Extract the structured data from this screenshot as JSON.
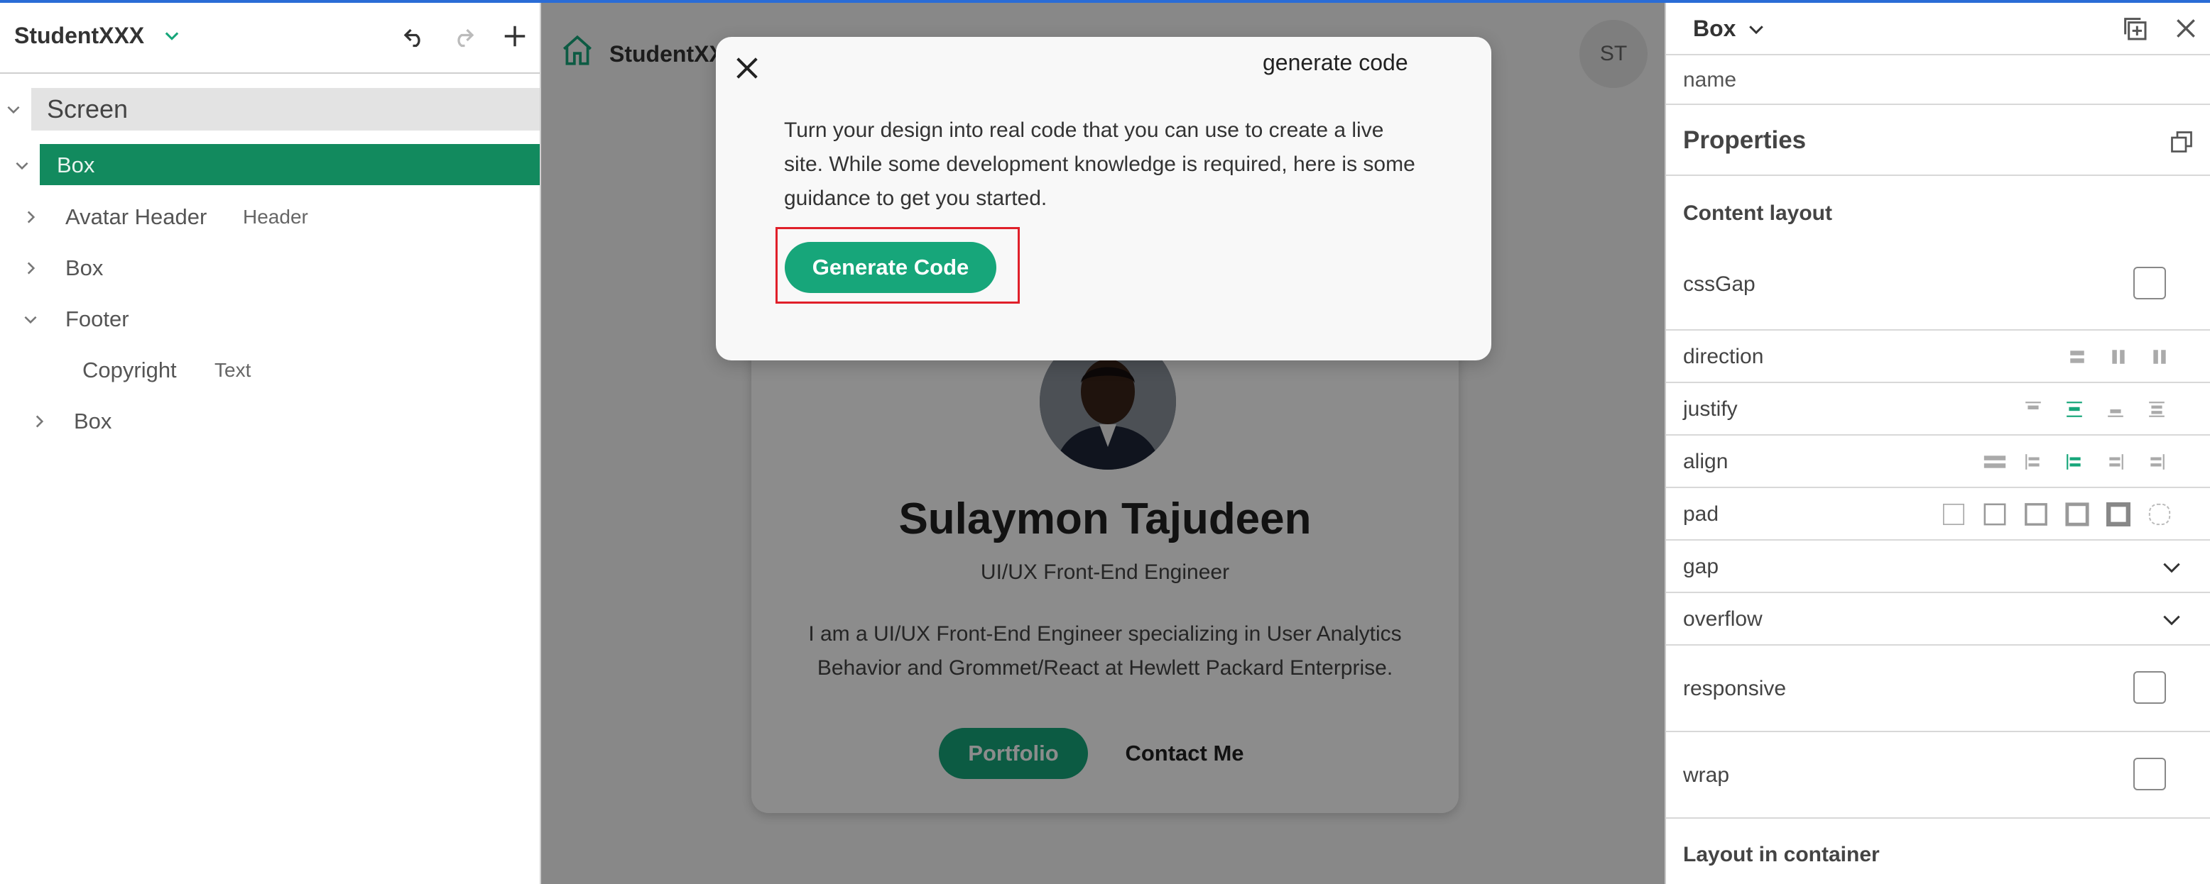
{
  "left_panel": {
    "app_title": "StudentXXX",
    "tree": [
      {
        "label": "Screen"
      },
      {
        "label": "Box"
      },
      {
        "label": "Avatar Header",
        "type": "Header"
      },
      {
        "label": "Box"
      },
      {
        "label": "Footer"
      },
      {
        "label": "Copyright",
        "type": "Text"
      },
      {
        "label": "Box"
      }
    ]
  },
  "canvas": {
    "brand": "StudentXXX",
    "avatar_initials": "ST",
    "profile": {
      "name": "Sulaymon Tajudeen",
      "role": "UI/UX Front-End Engineer",
      "bio": "I am a UI/UX Front-End Engineer specializing in User Analytics Behavior and Grommet/React at Hewlett Packard Enterprise.",
      "portfolio_label": "Portfolio",
      "contact_label": "Contact Me"
    }
  },
  "modal": {
    "title": "generate code",
    "description": "Turn your design into real code that you can use to create a live site. While some development knowledge is required, here is some guidance to get you started.",
    "button_label": "Generate Code"
  },
  "right_panel": {
    "component": "Box",
    "name_placeholder": "name",
    "properties_title": "Properties",
    "content_layout_title": "Content layout",
    "rows": {
      "cssgap": "cssGap",
      "direction": "direction",
      "justify": "justify",
      "align": "align",
      "pad": "pad",
      "gap": "gap",
      "overflow": "overflow",
      "responsive": "responsive",
      "wrap": "wrap"
    },
    "layout_container_title": "Layout in container"
  },
  "colors": {
    "accent": "#17a67a",
    "selection": "#128a5e",
    "highlight_border": "#e0202a"
  }
}
